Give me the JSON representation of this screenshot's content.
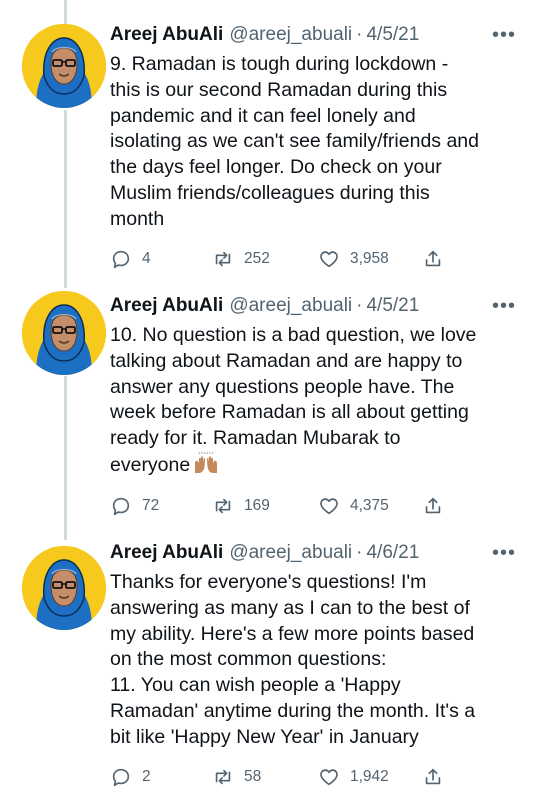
{
  "tweets": [
    {
      "name": "Areej AbuAli",
      "handle": "@areej_abuali",
      "date": "4/5/21",
      "text": "9. Ramadan is tough during lockdown -\nthis is our second Ramadan during this\npandemic and it can feel lonely and\nisolating as we can't see family/friends and\nthe days feel longer. Do check on your\nMuslim friends/colleagues during this\nmonth",
      "replies": "4",
      "retweets": "252",
      "likes": "3,958"
    },
    {
      "name": "Areej AbuAli",
      "handle": "@areej_abuali",
      "date": "4/5/21",
      "text": "10. No question is a bad question, we love\ntalking about Ramadan and are happy to\nanswer any questions people have. The\nweek before Ramadan is all about getting\nready for it. Ramadan Mubarak to\neveryone",
      "emoji": "raising-hands-emoji",
      "replies": "72",
      "retweets": "169",
      "likes": "4,375"
    },
    {
      "name": "Areej AbuAli",
      "handle": "@areej_abuali",
      "date": "4/6/21",
      "text": "Thanks for everyone's questions! I'm\nanswering as many as I can to the best of\nmy ability. Here's a few more points based\non the most common questions:\n11. You can wish people a 'Happy\nRamadan' anytime during the month. It's a\nbit like 'Happy New Year' in January",
      "replies": "2",
      "retweets": "58",
      "likes": "1,942"
    }
  ],
  "more_label": "•••",
  "separator": "·",
  "icons": {
    "reply": "reply-icon",
    "retweet": "retweet-icon",
    "like": "heart-icon",
    "share": "share-icon",
    "avatar": "avatar-illustration"
  },
  "colors": {
    "avatar_bg": "#f6c91c",
    "hijab": "#1d6fc4",
    "muted": "#536471",
    "thread_line": "#cfd9de"
  }
}
